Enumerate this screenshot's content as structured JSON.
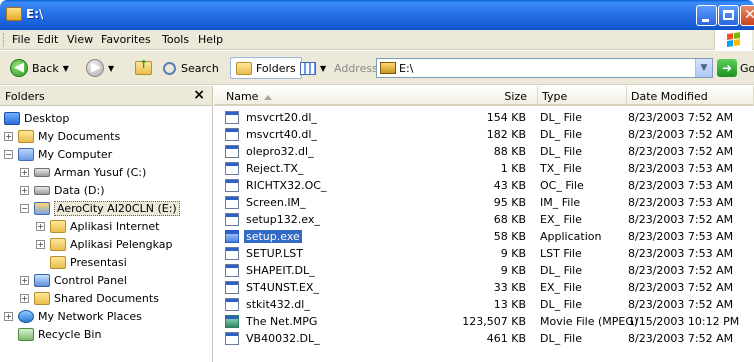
{
  "window": {
    "title": "E:\\"
  },
  "menu": [
    "File",
    "Edit",
    "View",
    "Favorites",
    "Tools",
    "Help"
  ],
  "toolbar": {
    "back_label": "Back",
    "search_label": "Search",
    "folders_label": "Folders",
    "address_label": "Address",
    "address_value": "E:\\",
    "go_label": "Go"
  },
  "folders_pane": {
    "title": "Folders",
    "tree": [
      {
        "label": "Desktop",
        "icon": "desktop-icon"
      },
      {
        "label": "My Documents",
        "icon": "folder-icon",
        "expander": "+"
      },
      {
        "label": "My Computer",
        "icon": "my-computer-icon",
        "expander": "-"
      },
      {
        "label": "Arman Yusuf (C:)",
        "icon": "hard-disk-icon",
        "expander": "+"
      },
      {
        "label": "Data (D:)",
        "icon": "hard-disk-icon",
        "expander": "+"
      },
      {
        "label": "AeroCity AI20CLN (E:)",
        "icon": "cd-drive-icon",
        "expander": "-",
        "selected": true
      },
      {
        "label": "Aplikasi Internet",
        "icon": "folder-icon",
        "expander": "+"
      },
      {
        "label": "Aplikasi Pelengkap",
        "icon": "folder-icon",
        "expander": "+"
      },
      {
        "label": "Presentasi",
        "icon": "folder-icon"
      },
      {
        "label": "Control Panel",
        "icon": "control-panel-icon",
        "expander": "+"
      },
      {
        "label": "Shared Documents",
        "icon": "folder-icon",
        "expander": "+"
      },
      {
        "label": "My Network Places",
        "icon": "network-places-icon",
        "expander": "+"
      },
      {
        "label": "Recycle Bin",
        "icon": "recycle-bin-icon"
      }
    ]
  },
  "file_list": {
    "columns": [
      "Name",
      "Size",
      "Type",
      "Date Modified"
    ],
    "rows": [
      {
        "name": "msvcrt20.dl_",
        "size": "154 KB",
        "type": "DL_ File",
        "date": "8/23/2003 7:52 AM"
      },
      {
        "name": "msvcrt40.dl_",
        "size": "182 KB",
        "type": "DL_ File",
        "date": "8/23/2003 7:52 AM"
      },
      {
        "name": "olepro32.dl_",
        "size": "88 KB",
        "type": "DL_ File",
        "date": "8/23/2003 7:52 AM"
      },
      {
        "name": "Reject.TX_",
        "size": "1 KB",
        "type": "TX_ File",
        "date": "8/23/2003 7:53 AM"
      },
      {
        "name": "RICHTX32.OC_",
        "size": "43 KB",
        "type": "OC_ File",
        "date": "8/23/2003 7:53 AM"
      },
      {
        "name": "Screen.IM_",
        "size": "95 KB",
        "type": "IM_ File",
        "date": "8/23/2003 7:53 AM"
      },
      {
        "name": "setup132.ex_",
        "size": "68 KB",
        "type": "EX_ File",
        "date": "8/23/2003 7:52 AM"
      },
      {
        "name": "setup.exe",
        "size": "58 KB",
        "type": "Application",
        "date": "8/23/2003 7:53 AM",
        "selected": true
      },
      {
        "name": "SETUP.LST",
        "size": "9 KB",
        "type": "LST File",
        "date": "8/23/2003 7:53 AM"
      },
      {
        "name": "SHAPEIT.DL_",
        "size": "9 KB",
        "type": "DL_ File",
        "date": "8/23/2003 7:52 AM"
      },
      {
        "name": "ST4UNST.EX_",
        "size": "33 KB",
        "type": "EX_ File",
        "date": "8/23/2003 7:52 AM"
      },
      {
        "name": "stkit432.dl_",
        "size": "13 KB",
        "type": "DL_ File",
        "date": "8/23/2003 7:52 AM"
      },
      {
        "name": "The Net.MPG",
        "size": "123,507 KB",
        "type": "Movie File (MPEG)",
        "date": "1/15/2003 10:12 PM"
      },
      {
        "name": "VB40032.DL_",
        "size": "461 KB",
        "type": "DL_ File",
        "date": "8/23/2003 7:52 AM"
      }
    ]
  }
}
